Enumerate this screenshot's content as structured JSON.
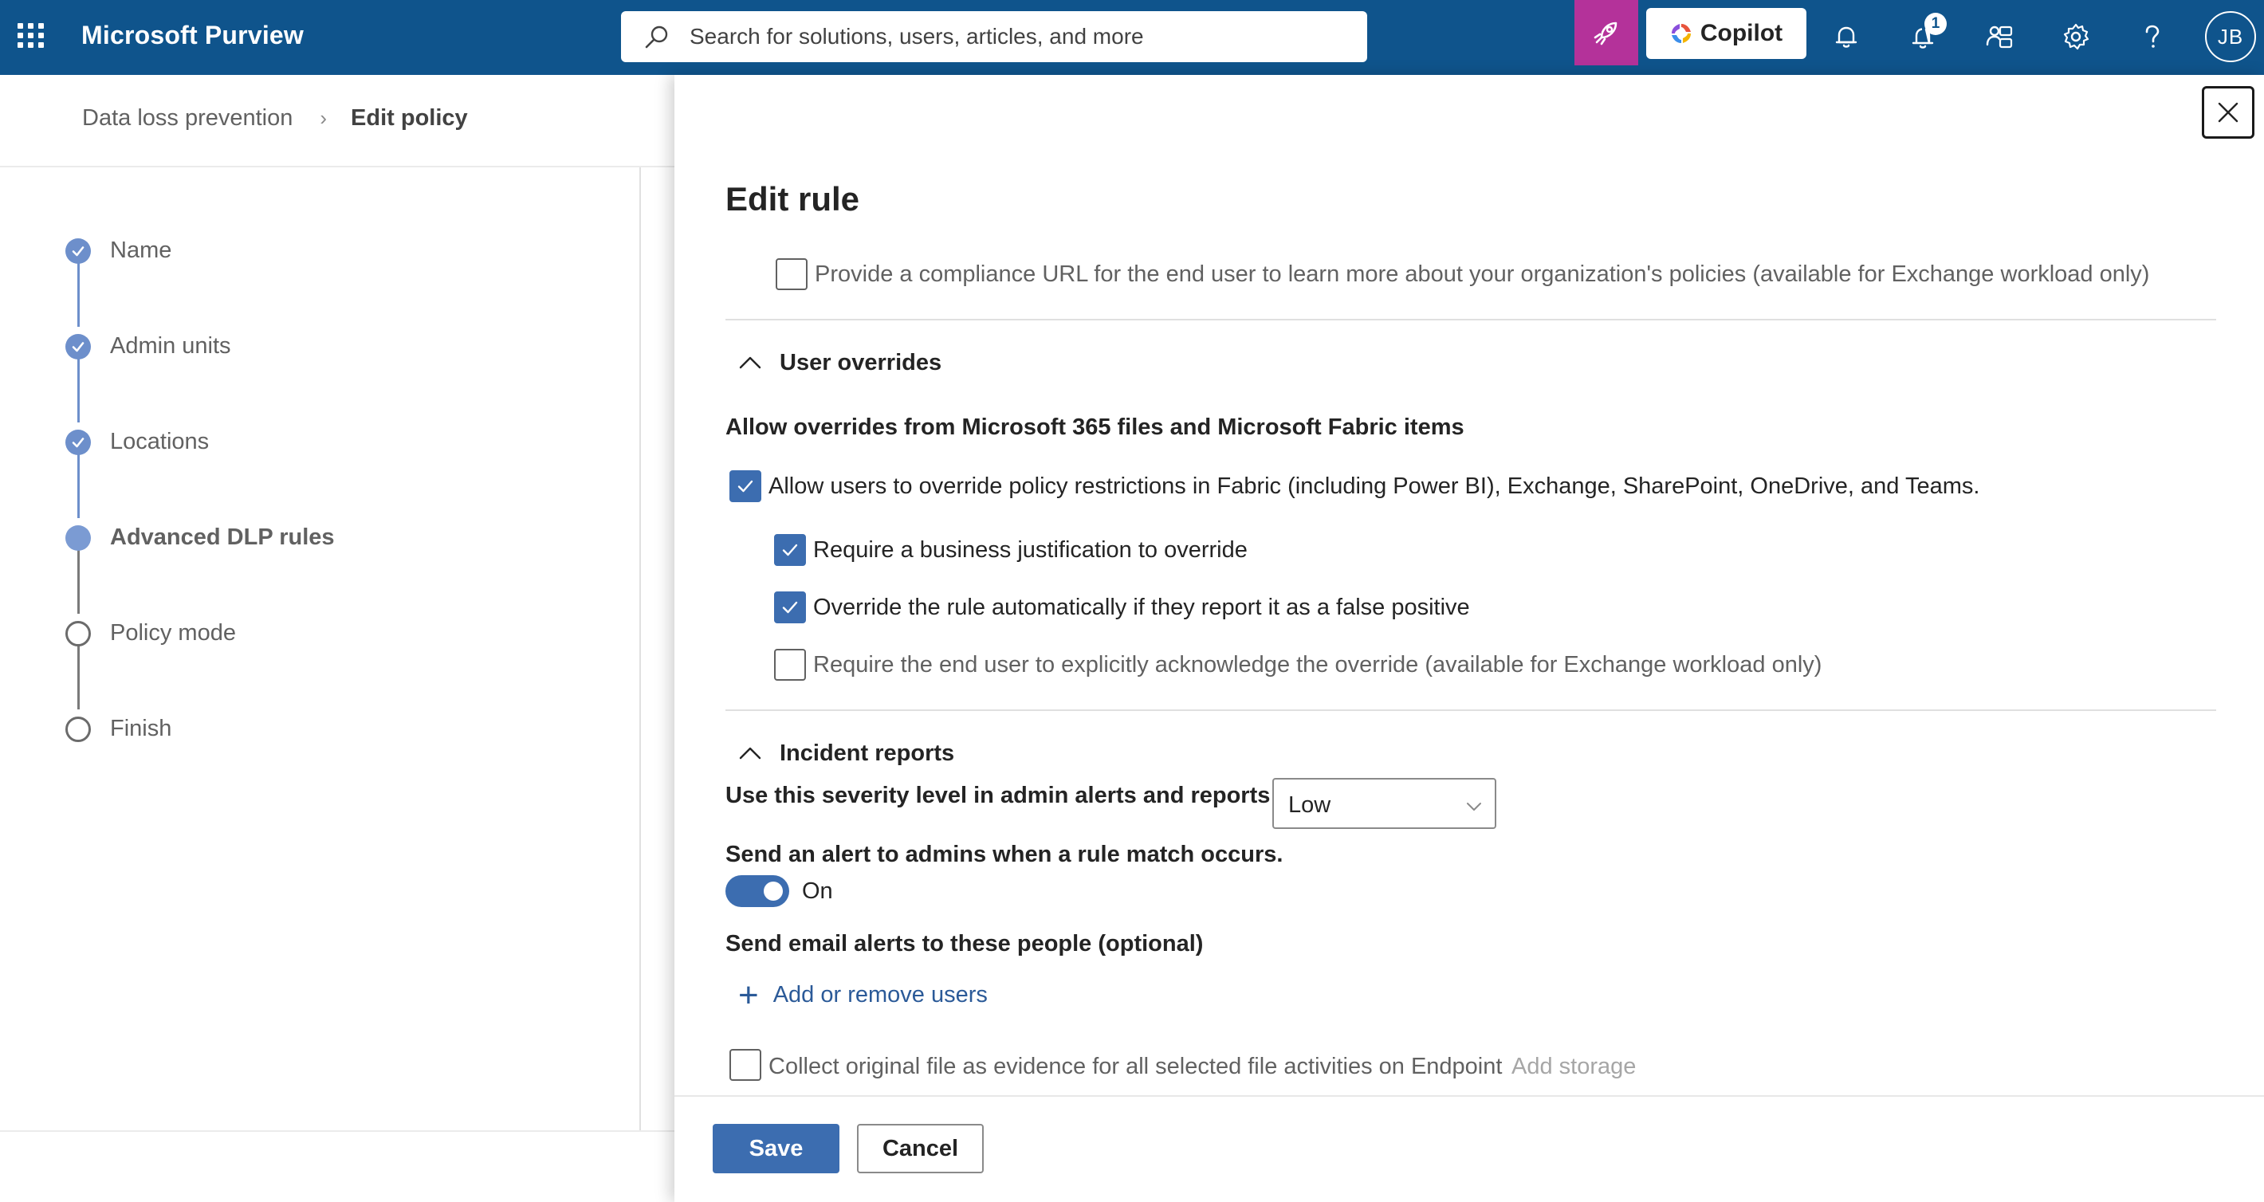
{
  "topbar": {
    "app_title": "Microsoft Purview",
    "search_placeholder": "Search for solutions, users, articles, and more",
    "copilot_label": "Copilot",
    "notification_count": "1",
    "avatar_initials": "JB",
    "colors": {
      "bar": "#0f548c",
      "launch_button": "#b4329a"
    }
  },
  "breadcrumb": {
    "root": "Data loss prevention",
    "current": "Edit policy"
  },
  "wizard": {
    "steps": [
      {
        "label": "Name",
        "state": "completed"
      },
      {
        "label": "Admin units",
        "state": "completed"
      },
      {
        "label": "Locations",
        "state": "completed"
      },
      {
        "label": "Advanced DLP rules",
        "state": "current"
      },
      {
        "label": "Policy mode",
        "state": "pending"
      },
      {
        "label": "Finish",
        "state": "pending"
      }
    ]
  },
  "panel": {
    "title": "Edit rule",
    "compliance_url": {
      "label": "Provide a compliance URL for the end user to learn more about your organization's policies (available for Exchange workload only)",
      "checked": false
    },
    "user_overrides": {
      "heading": "User overrides",
      "subheading": "Allow overrides from Microsoft 365 files and Microsoft Fabric items",
      "allow_override": {
        "label": "Allow users to override policy restrictions in Fabric (including Power BI), Exchange, SharePoint, OneDrive, and Teams.",
        "checked": true
      },
      "require_justification": {
        "label": "Require a business justification to override",
        "checked": true
      },
      "auto_override": {
        "label": "Override the rule automatically if they report it as a false positive",
        "checked": true
      },
      "acknowledge": {
        "label": "Require the end user to explicitly acknowledge the override (available for Exchange workload only)",
        "checked": false
      }
    },
    "incident_reports": {
      "heading": "Incident reports",
      "severity_label": "Use this severity level in admin alerts and reports:",
      "severity_value": "Low",
      "alert_label": "Send an alert to admins when a rule match occurs.",
      "alert_toggle_state": "On",
      "email_label": "Send email alerts to these people (optional)",
      "add_users_label": "Add or remove users",
      "collect_evidence": {
        "label": "Collect original file as evidence for all selected file activities on Endpoint",
        "checked": false
      },
      "add_storage_label": "Add storage"
    },
    "footer": {
      "save_label": "Save",
      "cancel_label": "Cancel"
    }
  },
  "colors": {
    "accent": "#3c6db0",
    "step_done": "#6d8fcb",
    "link": "#2b5a98"
  }
}
